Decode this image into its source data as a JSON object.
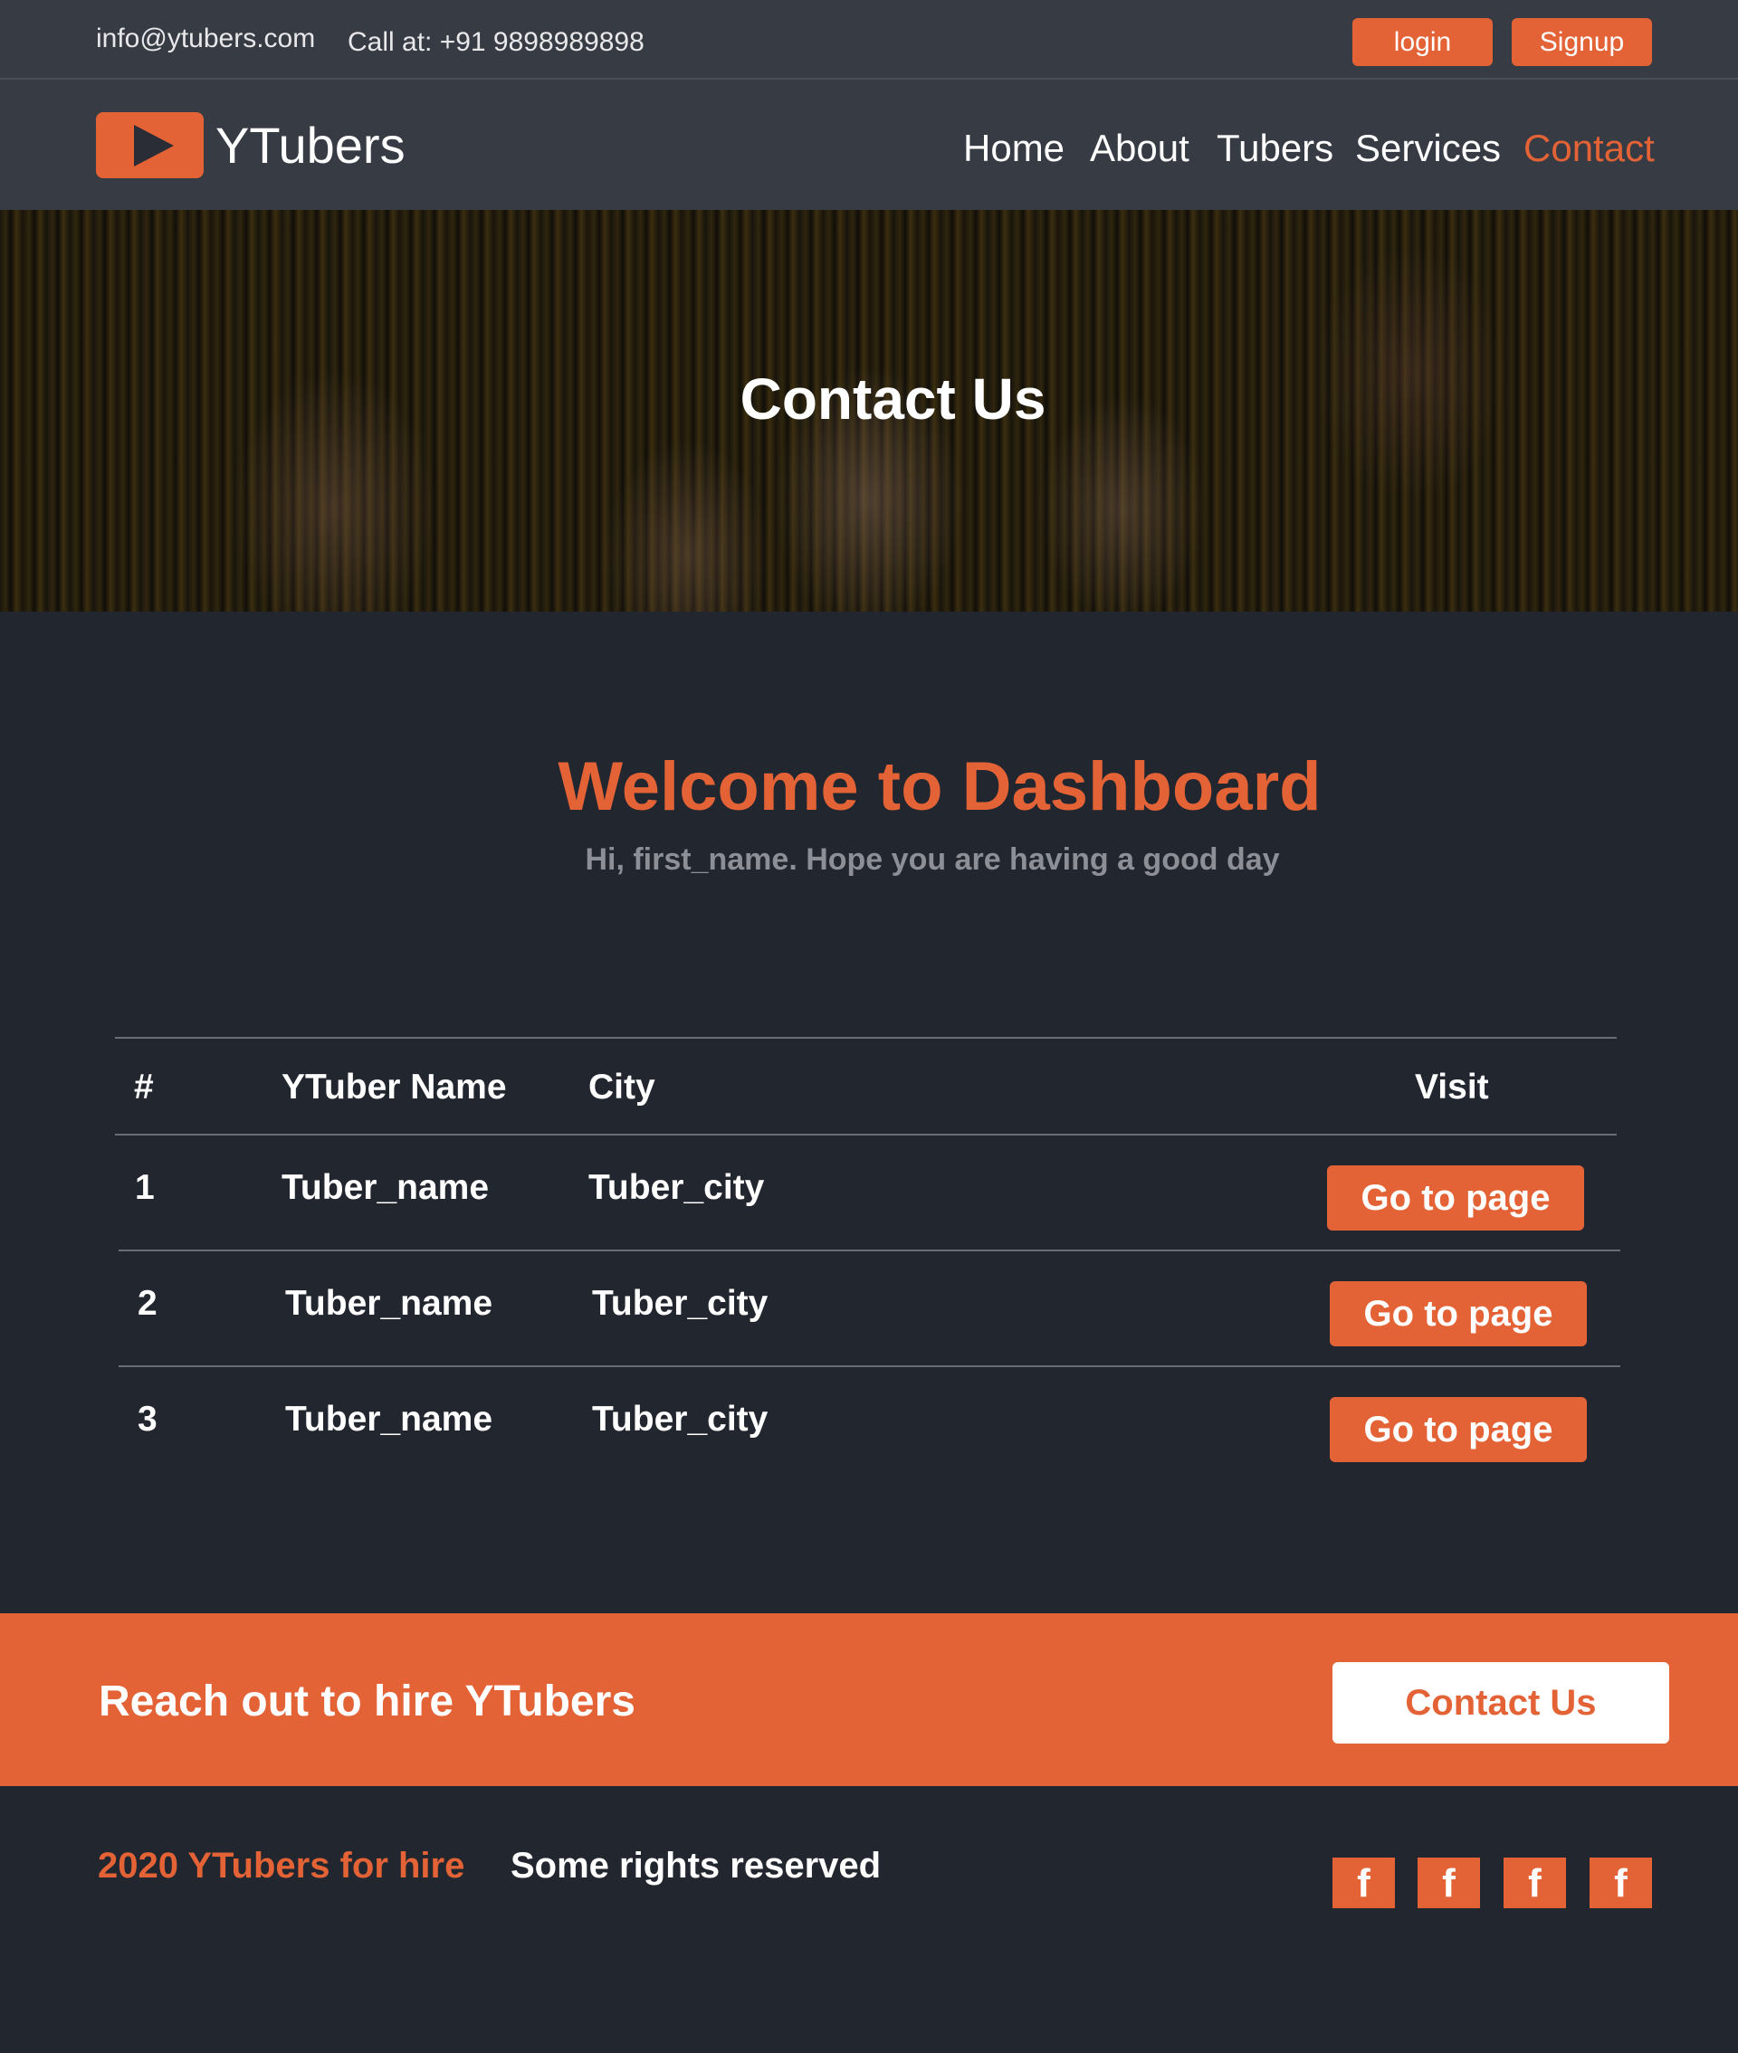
{
  "topbar": {
    "email": "info@ytubers.com",
    "phone": "Call at: +91 9898989898",
    "login_label": "login",
    "signup_label": "Signup"
  },
  "nav": {
    "brand": "YTubers",
    "items": [
      {
        "label": "Home"
      },
      {
        "label": "About"
      },
      {
        "label": "Tubers"
      },
      {
        "label": "Services"
      },
      {
        "label": "Contact"
      }
    ],
    "active": "Contact"
  },
  "hero": {
    "title": "Contact Us"
  },
  "dashboard": {
    "title": "Welcome to Dashboard",
    "subtitle": "Hi, first_name. Hope you are having a good day"
  },
  "table": {
    "headers": [
      "#",
      "YTuber Name",
      "City",
      "Visit"
    ],
    "rows": [
      {
        "num": "1",
        "name": "Tuber_name",
        "city": "Tuber_city",
        "action": "Go to page"
      },
      {
        "num": "2",
        "name": "Tuber_name",
        "city": "Tuber_city",
        "action": "Go to page"
      },
      {
        "num": "3",
        "name": "Tuber_name",
        "city": "Tuber_city",
        "action": "Go to page"
      }
    ]
  },
  "cta": {
    "text": "Reach out to hire YTubers",
    "button_label": "Contact Us"
  },
  "footer": {
    "copyright": "2020 YTubers for hire",
    "rights": "Some rights reserved",
    "social_icons": [
      {
        "icon": "facebook-icon",
        "glyph": "f"
      },
      {
        "icon": "facebook-icon",
        "glyph": "f"
      },
      {
        "icon": "facebook-icon",
        "glyph": "f"
      },
      {
        "icon": "facebook-icon",
        "glyph": "f"
      }
    ]
  },
  "colors": {
    "accent": "#e36336",
    "background": "#22262f",
    "header": "#373b44"
  }
}
